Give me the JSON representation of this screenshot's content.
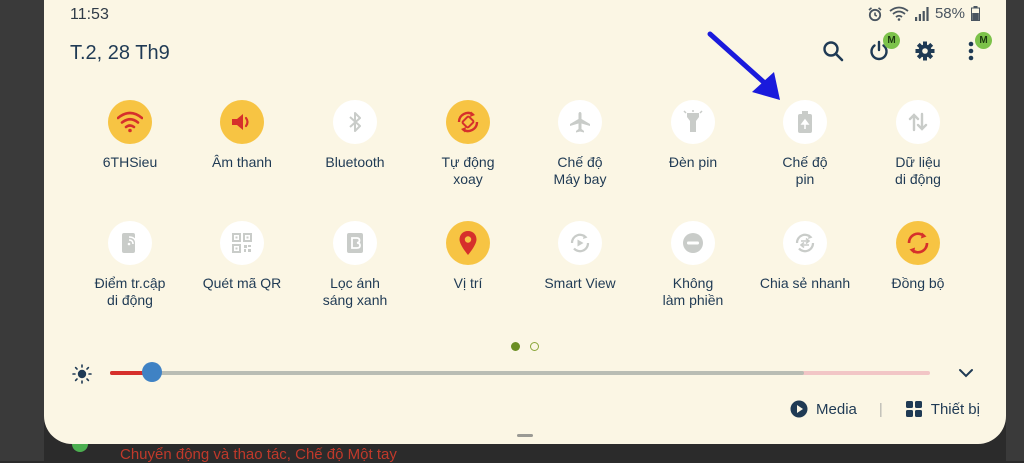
{
  "status_bar": {
    "time": "11:53",
    "battery": "58%"
  },
  "header": {
    "date": "T.2, 28 Th9",
    "badge_letter": "M"
  },
  "tiles": [
    {
      "label": "6THSieu",
      "state": "on",
      "icon": "wifi-icon"
    },
    {
      "label": "Âm thanh",
      "state": "on",
      "icon": "sound-icon"
    },
    {
      "label": "Bluetooth",
      "state": "off",
      "icon": "bluetooth-icon"
    },
    {
      "label": "Tự động\nxoay",
      "state": "on",
      "icon": "auto-rotate-icon"
    },
    {
      "label": "Chế độ\nMáy bay",
      "state": "off",
      "icon": "airplane-icon"
    },
    {
      "label": "Đèn pin",
      "state": "off",
      "icon": "flashlight-icon"
    },
    {
      "label": "Chế độ\npin",
      "state": "off",
      "icon": "battery-mode-icon"
    },
    {
      "label": "Dữ liệu\ndi động",
      "state": "off",
      "icon": "mobile-data-icon"
    },
    {
      "label": "Điểm tr.cập\ndi động",
      "state": "off",
      "icon": "hotspot-icon"
    },
    {
      "label": "Quét mã QR",
      "state": "off",
      "icon": "qr-icon"
    },
    {
      "label": "Lọc ánh\nsáng xanh",
      "state": "off",
      "icon": "blue-light-icon"
    },
    {
      "label": "Vị trí",
      "state": "on",
      "icon": "location-icon"
    },
    {
      "label": "Smart View",
      "state": "off",
      "icon": "smart-view-icon"
    },
    {
      "label": "Không\nlàm phiền",
      "state": "off",
      "icon": "do-not-disturb-icon"
    },
    {
      "label": "Chia sẻ nhanh",
      "state": "off",
      "icon": "quick-share-icon"
    },
    {
      "label": "Đồng bộ",
      "state": "on",
      "icon": "sync-icon"
    }
  ],
  "brightness": {
    "level_fraction": 0.05
  },
  "pager": {
    "pages": 2,
    "current": 1
  },
  "bottom": {
    "media_label": "Media",
    "devices_label": "Thiết bị"
  },
  "background": {
    "behind_text": "Chuyển động và thao tác, Chế độ Một tay"
  },
  "colors": {
    "panel": "#fbf6e4",
    "tile_on": "#f7c443",
    "tile_off": "#ffffff",
    "icon_on": "#d6302b",
    "icon_off": "#c9ccc9",
    "accent_text": "#1f3a54",
    "slider_thumb": "#3f82c4",
    "arrow": "#1a1adc"
  }
}
